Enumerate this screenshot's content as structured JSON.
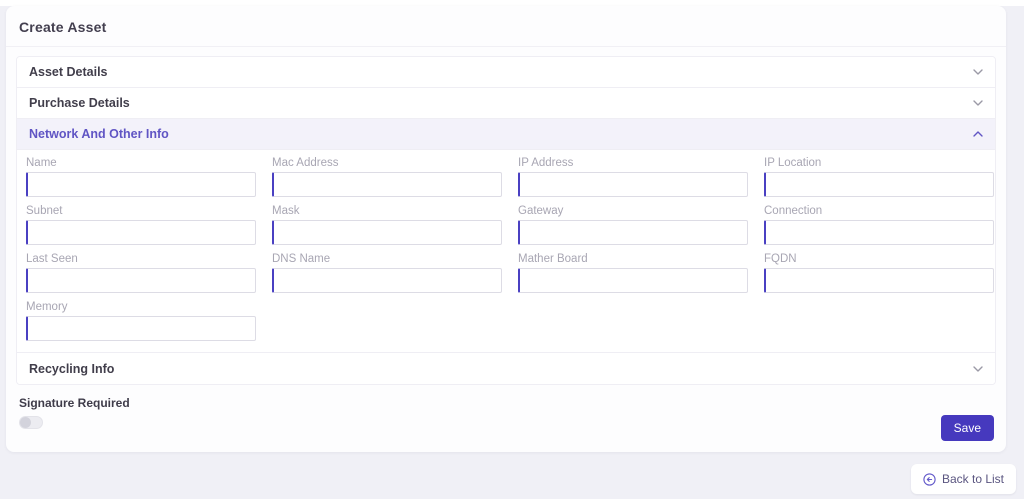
{
  "page": {
    "title": "Create Asset"
  },
  "accordion": {
    "sections": [
      {
        "label": "Asset Details",
        "expanded": false
      },
      {
        "label": "Purchase Details",
        "expanded": false
      },
      {
        "label": "Network And Other Info",
        "expanded": true
      },
      {
        "label": "Recycling Info",
        "expanded": false
      }
    ]
  },
  "form": {
    "fields": [
      {
        "label": "Name",
        "value": ""
      },
      {
        "label": "Mac Address",
        "value": ""
      },
      {
        "label": "IP Address",
        "value": ""
      },
      {
        "label": "IP Location",
        "value": ""
      },
      {
        "label": "Subnet",
        "value": ""
      },
      {
        "label": "Mask",
        "value": ""
      },
      {
        "label": "Gateway",
        "value": ""
      },
      {
        "label": "Connection",
        "value": ""
      },
      {
        "label": "Last Seen",
        "value": ""
      },
      {
        "label": "DNS Name",
        "value": ""
      },
      {
        "label": "Mather Board",
        "value": ""
      },
      {
        "label": "FQDN",
        "value": ""
      },
      {
        "label": "Memory",
        "value": ""
      }
    ]
  },
  "signature": {
    "label": "Signature Required",
    "state": "off"
  },
  "actions": {
    "save": "Save",
    "back": "Back to List"
  },
  "colors": {
    "accent": "#4639be",
    "input_accent": "#4a40c2",
    "active_section_bg": "#f3f2fa",
    "active_section_text": "#6055c4",
    "page_bg": "#f0f0f6"
  }
}
